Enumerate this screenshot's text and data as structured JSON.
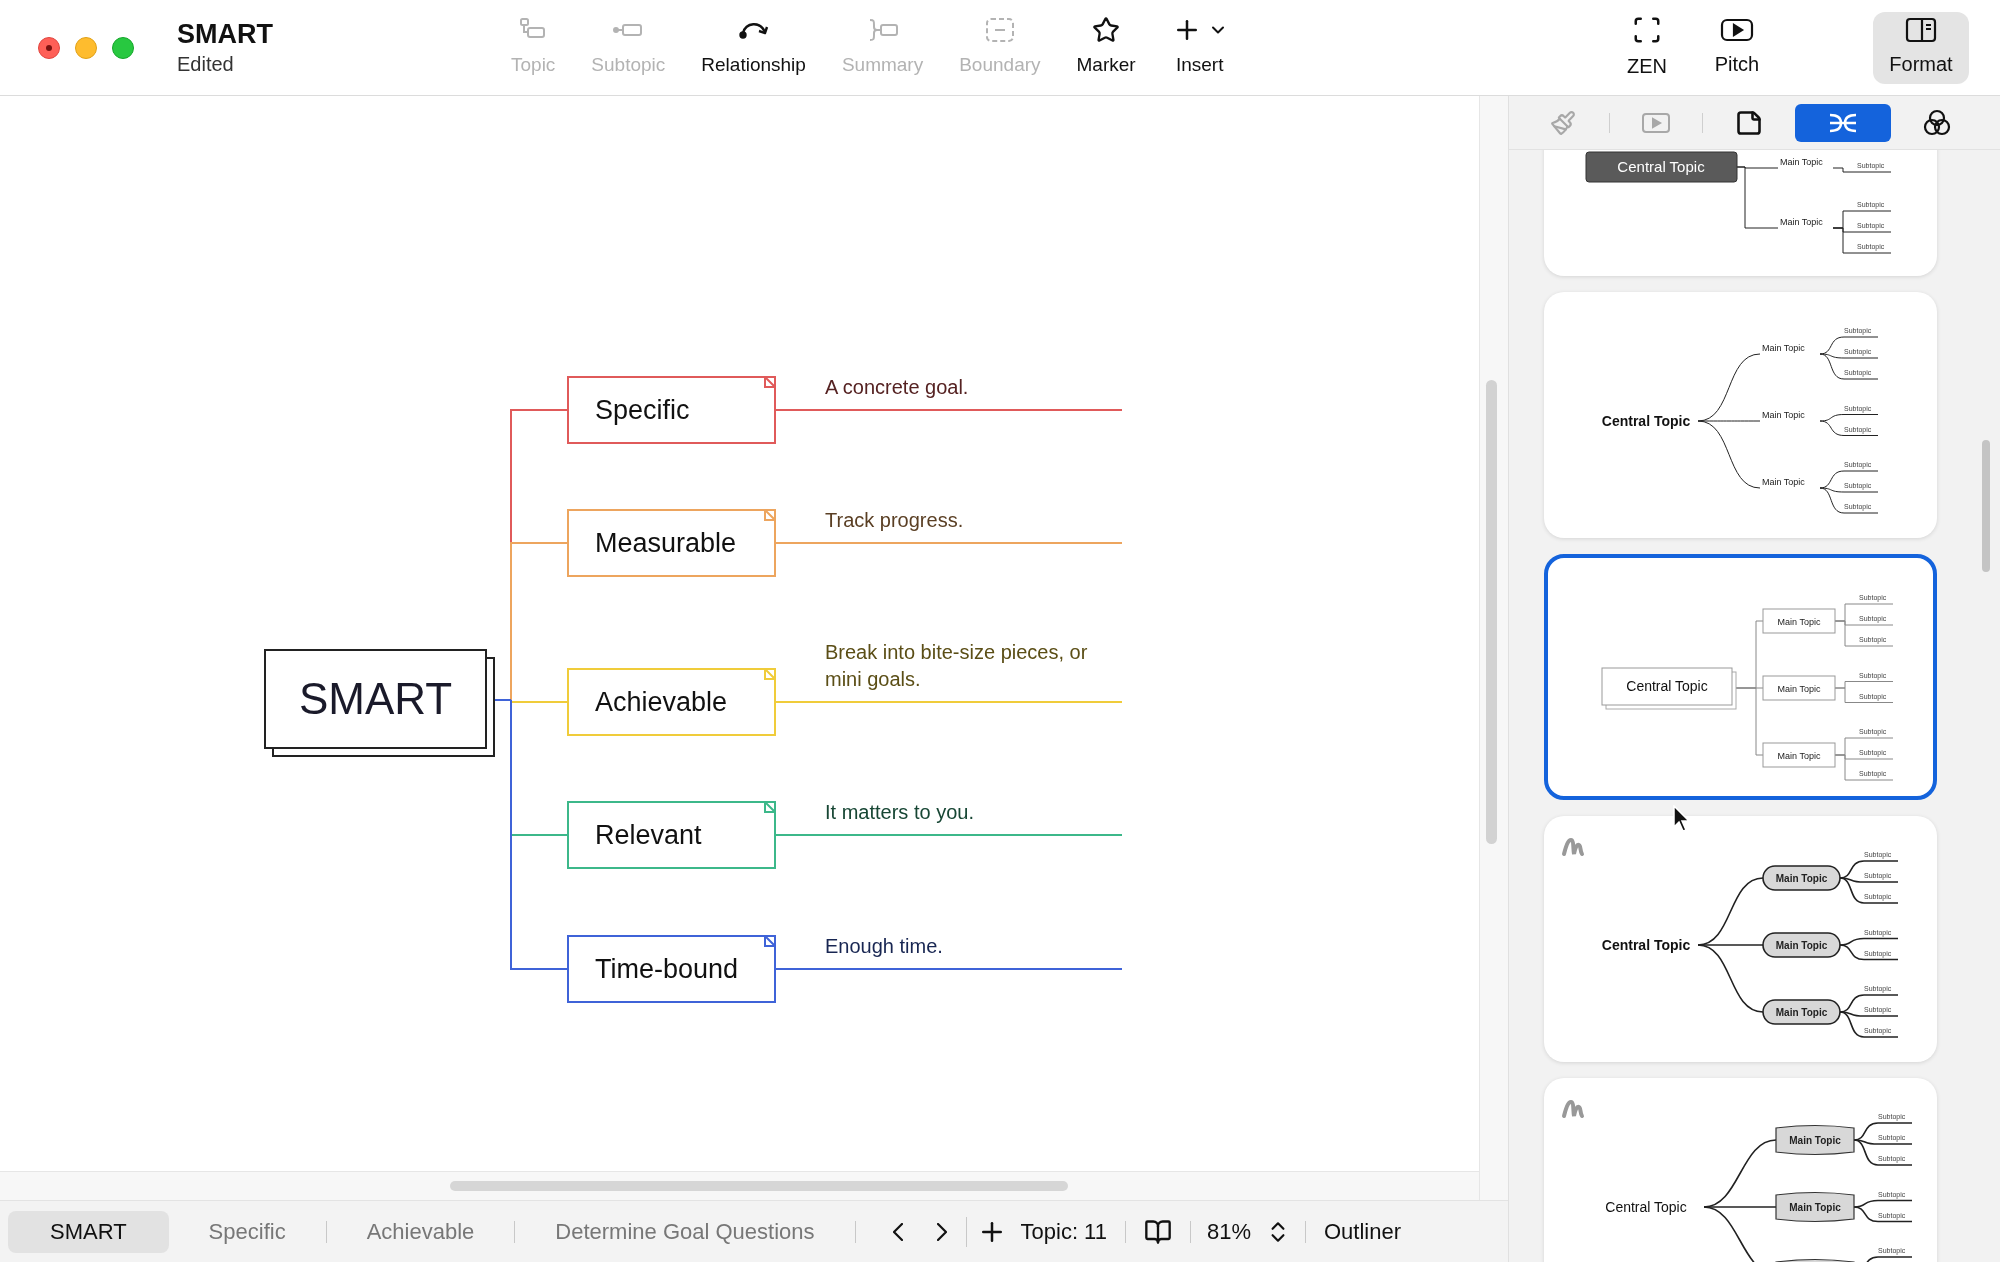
{
  "window": {
    "title": "SMART",
    "subtitle": "Edited"
  },
  "toolbar": [
    {
      "label": "Topic",
      "disabled": true
    },
    {
      "label": "Subtopic",
      "disabled": true
    },
    {
      "label": "Relationship",
      "disabled": false
    },
    {
      "label": "Summary",
      "disabled": true
    },
    {
      "label": "Boundary",
      "disabled": true
    },
    {
      "label": "Marker",
      "disabled": false
    },
    {
      "label": "Insert",
      "disabled": false
    }
  ],
  "view_buttons": [
    {
      "label": "ZEN",
      "selected": false
    },
    {
      "label": "Pitch",
      "selected": false
    },
    {
      "label": "Format",
      "selected": true
    }
  ],
  "mindmap": {
    "central": "SMART",
    "topics": [
      {
        "label": "Specific",
        "note": "A concrete goal.",
        "color": "#e05a5a"
      },
      {
        "label": "Measurable",
        "note": "Track progress.",
        "color": "#eda55e"
      },
      {
        "label": "Achievable",
        "note": "Break into bite-size pieces, or mini goals.",
        "color": "#f0cc3a"
      },
      {
        "label": "Relevant",
        "note": "It matters to you.",
        "color": "#3cb88a"
      },
      {
        "label": "Time-bound",
        "note": "Enough time.",
        "color": "#3f63d8"
      }
    ]
  },
  "panel_tabs": [
    {
      "selected": false,
      "disabled": true
    },
    {
      "selected": false,
      "disabled": true
    },
    {
      "selected": false,
      "disabled": false
    },
    {
      "selected": true,
      "disabled": false
    },
    {
      "selected": false,
      "disabled": false
    }
  ],
  "templates": [
    {
      "kind": "dark",
      "selected": false,
      "handdrawn": false,
      "central": "Central Topic",
      "mains": [
        {
          "label": "Main Topic",
          "subtopics": [
            "Subtopic"
          ]
        },
        {
          "label": "Main Topic",
          "subtopics": [
            "Subtopic",
            "Subtopic",
            "Subtopic"
          ]
        }
      ]
    },
    {
      "kind": "curve",
      "selected": false,
      "handdrawn": false,
      "central": "Central Topic",
      "mains": [
        {
          "label": "Main Topic",
          "subtopics": [
            "Subtopic",
            "Subtopic",
            "Subtopic"
          ]
        },
        {
          "label": "Main Topic",
          "subtopics": [
            "Subtopic",
            "Subtopic"
          ]
        },
        {
          "label": "Main Topic",
          "subtopics": [
            "Subtopic",
            "Subtopic",
            "Subtopic"
          ]
        }
      ]
    },
    {
      "kind": "boxed",
      "selected": true,
      "handdrawn": false,
      "central": "Central Topic",
      "mains": [
        {
          "label": "Main Topic",
          "subtopics": [
            "Subtopic",
            "Subtopic",
            "Subtopic"
          ]
        },
        {
          "label": "Main Topic",
          "subtopics": [
            "Subtopic",
            "Subtopic"
          ]
        },
        {
          "label": "Main Topic",
          "subtopics": [
            "Subtopic",
            "Subtopic",
            "Subtopic"
          ]
        }
      ]
    },
    {
      "kind": "pill",
      "selected": false,
      "handdrawn": true,
      "central": "Central Topic",
      "mains": [
        {
          "label": "Main Topic",
          "subtopics": [
            "Subtopic",
            "Subtopic",
            "Subtopic"
          ]
        },
        {
          "label": "Main Topic",
          "subtopics": [
            "Subtopic",
            "Subtopic"
          ]
        },
        {
          "label": "Main Topic",
          "subtopics": [
            "Subtopic",
            "Subtopic",
            "Subtopic"
          ]
        }
      ]
    },
    {
      "kind": "hex",
      "selected": false,
      "handdrawn": true,
      "central": "Central Topic",
      "mains": [
        {
          "label": "Main Topic",
          "subtopics": [
            "Subtopic",
            "Subtopic",
            "Subtopic"
          ]
        },
        {
          "label": "Main Topic",
          "subtopics": [
            "Subtopic",
            "Subtopic"
          ]
        },
        {
          "subtopics": [
            "Subtopic"
          ]
        }
      ]
    }
  ],
  "sheet_tabs": [
    {
      "label": "SMART",
      "selected": true
    },
    {
      "label": "Specific",
      "selected": false
    },
    {
      "label": "Achievable",
      "selected": false
    },
    {
      "label": "Determine Goal Questions",
      "selected": false
    }
  ],
  "status": {
    "topic_count": "Topic: 11",
    "zoom": "81%",
    "outliner": "Outliner"
  }
}
